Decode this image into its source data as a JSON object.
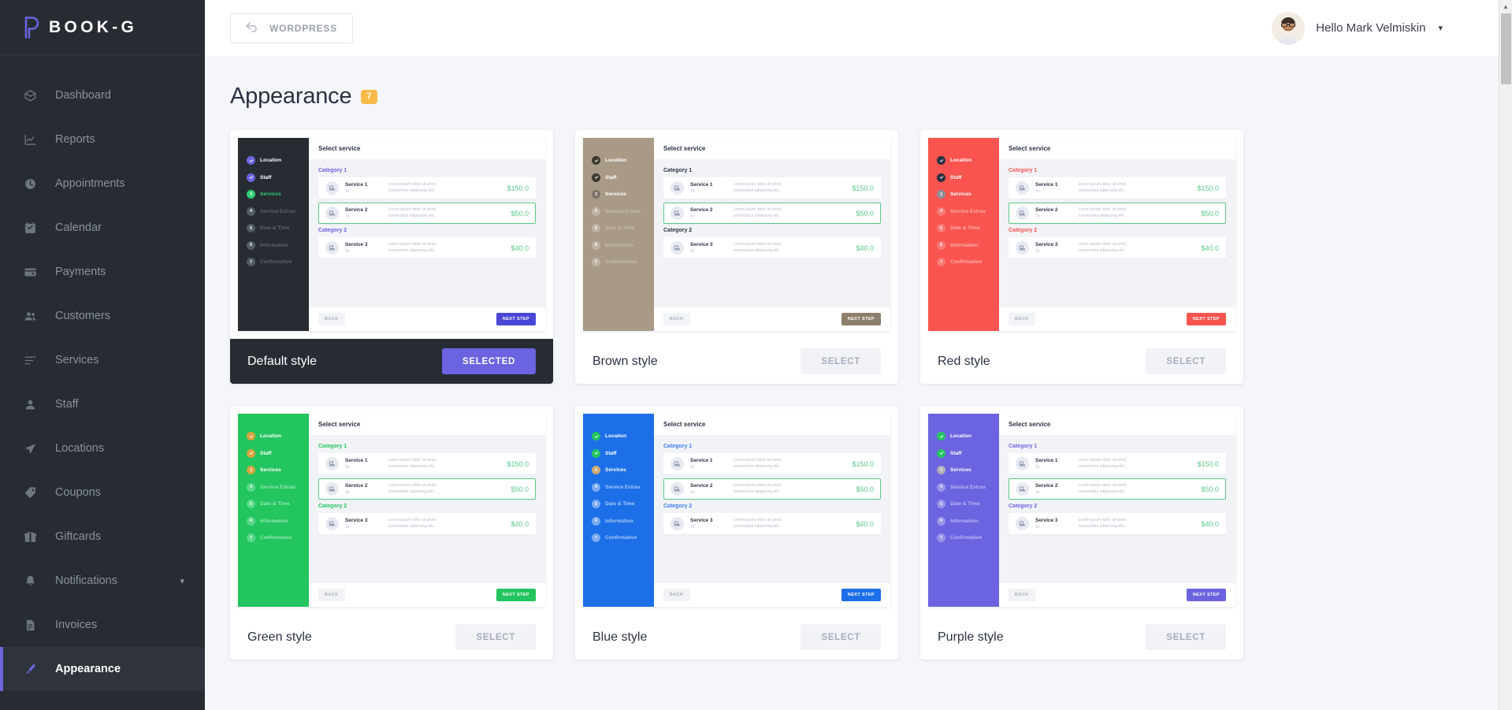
{
  "brand": {
    "name": "BOOK-G",
    "logo_icon": "book-logo-icon"
  },
  "sidebar": {
    "items": [
      {
        "label": "Dashboard",
        "icon": "box-icon",
        "active": false
      },
      {
        "label": "Reports",
        "icon": "chart-icon",
        "active": false
      },
      {
        "label": "Appointments",
        "icon": "clock-icon",
        "active": false
      },
      {
        "label": "Calendar",
        "icon": "calendar-icon",
        "active": false
      },
      {
        "label": "Payments",
        "icon": "wallet-icon",
        "active": false
      },
      {
        "label": "Customers",
        "icon": "users-icon",
        "active": false
      },
      {
        "label": "Services",
        "icon": "list-icon",
        "active": false
      },
      {
        "label": "Staff",
        "icon": "user-icon",
        "active": false
      },
      {
        "label": "Locations",
        "icon": "send-icon",
        "active": false
      },
      {
        "label": "Coupons",
        "icon": "tag-icon",
        "active": false
      },
      {
        "label": "Giftcards",
        "icon": "gift-icon",
        "active": false
      },
      {
        "label": "Notifications",
        "icon": "bell-icon",
        "active": false,
        "caret": true
      },
      {
        "label": "Invoices",
        "icon": "document-icon",
        "active": false
      },
      {
        "label": "Appearance",
        "icon": "brush-icon",
        "active": true
      }
    ]
  },
  "topbar": {
    "wordpress_label": "WORDPRESS",
    "wordpress_icon": "back-arrow-icon",
    "profile_greeting": "Hello Mark Velmiskin",
    "profile_caret_icon": "chevron-down-icon",
    "avatar_name": "avatar"
  },
  "page": {
    "title": "Appearance",
    "badge": "7"
  },
  "preview": {
    "steps": [
      {
        "label": "Location",
        "num": "1",
        "state": "done"
      },
      {
        "label": "Staff",
        "num": "2",
        "state": "done"
      },
      {
        "label": "Services",
        "num": "3",
        "state": "current"
      },
      {
        "label": "Service Extras",
        "num": "4",
        "state": "todo"
      },
      {
        "label": "Date & Time",
        "num": "5",
        "state": "todo"
      },
      {
        "label": "Information",
        "num": "6",
        "state": "todo"
      },
      {
        "label": "Confirmation",
        "num": "7",
        "state": "todo"
      }
    ],
    "header": "Select service",
    "category_1": "Category 1",
    "category_2": "Category 2",
    "services": [
      {
        "name": "Service 1",
        "sub": "1h",
        "desc1": "Lorem ipsum dolor sit amet,",
        "desc2": "consectetur adipiscing elit...",
        "price": "$150.0",
        "selected": false
      },
      {
        "name": "Service 2",
        "sub": "1h",
        "desc1": "Lorem ipsum dolor sit amet,",
        "desc2": "consectetur adipiscing elit...",
        "price": "$50.0",
        "selected": true
      },
      {
        "name": "Service 3",
        "sub": "1h",
        "desc1": "Lorem ipsum dolor sit amet,",
        "desc2": "consectetur adipiscing elit...",
        "price": "$40.0",
        "selected": false
      }
    ],
    "back_label": "BACK",
    "next_label": "NEXT STEP"
  },
  "buttons": {
    "selected_label": "SELECTED",
    "select_label": "SELECT"
  },
  "styles": [
    {
      "name": "Default style",
      "selected": true,
      "side_bg": "#272c33",
      "accent": "#6c63e0",
      "cat_color": "#6c63e0",
      "done_dot": "#6c63e0",
      "current_dot": "#2ecc71",
      "todo_dot": "#555b64",
      "label_done": "#ffffff",
      "label_current": "#2ecc71",
      "label_todo": "#5d636c",
      "next_bg": "#4a46d6"
    },
    {
      "name": "Brown style",
      "selected": false,
      "side_bg": "#a89a86",
      "accent": "#8d7f6b",
      "cat_color": "#2b3243",
      "done_dot": "#3d3a33",
      "current_dot": "#7e736a",
      "todo_dot": "#bfb4a3",
      "label_done": "#ffffff",
      "label_current": "#ffffff",
      "label_todo": "#c7bcab",
      "next_bg": "#8d7f6b"
    },
    {
      "name": "Red style",
      "selected": false,
      "side_bg": "#f9544f",
      "accent": "#f9544f",
      "cat_color": "#f9544f",
      "done_dot": "#2b3243",
      "current_dot": "#8e8e96",
      "todo_dot": "#fb7a76",
      "label_done": "#ffffff",
      "label_current": "#ffffff",
      "label_todo": "#fdaeab",
      "next_bg": "#f9544f"
    },
    {
      "name": "Green style",
      "selected": false,
      "side_bg": "#22c55e",
      "accent": "#22c55e",
      "cat_color": "#22c55e",
      "done_dot": "#d9a441",
      "current_dot": "#d9a441",
      "todo_dot": "#5ad98c",
      "label_done": "#ffffff",
      "label_current": "#ffffff",
      "label_todo": "#97e7b6",
      "next_bg": "#22c55e"
    },
    {
      "name": "Blue style",
      "selected": false,
      "side_bg": "#1d6fe8",
      "accent": "#1d6fe8",
      "cat_color": "#3d7fe9",
      "done_dot": "#22c55e",
      "current_dot": "#cdab72",
      "todo_dot": "#7aaaf0",
      "label_done": "#ffffff",
      "label_current": "#ffffff",
      "label_todo": "#a9c8f6",
      "next_bg": "#1d6fe8"
    },
    {
      "name": "Purple style",
      "selected": false,
      "side_bg": "#6c63e0",
      "accent": "#6c63e0",
      "cat_color": "#6c63e0",
      "done_dot": "#22c55e",
      "current_dot": "#b2aeb8",
      "todo_dot": "#9b94ea",
      "label_done": "#ffffff",
      "label_current": "#ffffff",
      "label_todo": "#bdb8f2",
      "next_bg": "#6c63e0"
    }
  ],
  "scrollbar": {
    "up_icon": "caret-up-icon",
    "down_icon": "caret-down-icon"
  }
}
